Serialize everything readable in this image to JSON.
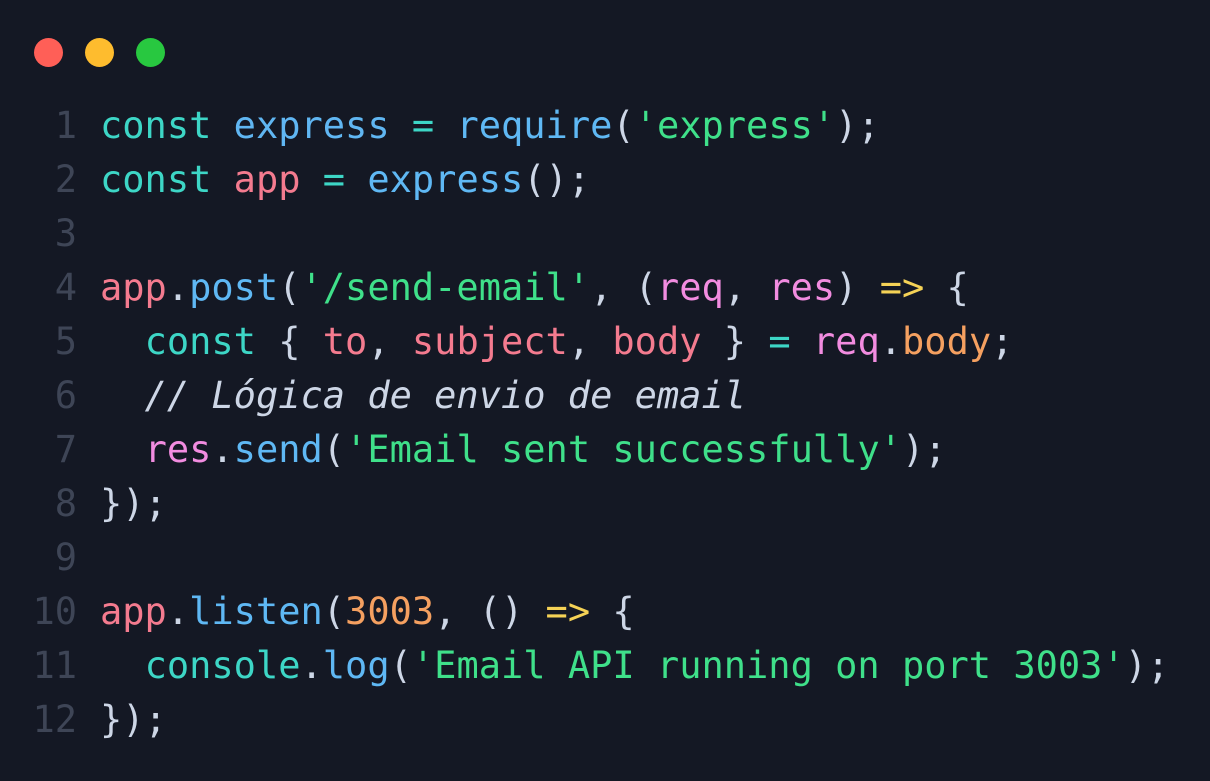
{
  "window": {
    "controls": [
      {
        "name": "close",
        "color": "#ff5f57"
      },
      {
        "name": "minimize",
        "color": "#febc2e"
      },
      {
        "name": "maximize",
        "color": "#28c840"
      }
    ]
  },
  "colors": {
    "background": "#141824",
    "keyword": "#3dd6c6",
    "variable": "#60b6f2",
    "variable_alt": "#f47b8f",
    "function": "#5fb8f4",
    "string": "#3fe08a",
    "param": "#f28ce0",
    "property": "#f5a060",
    "number": "#f5a060",
    "operator": "#f5d256",
    "punct": "#cdd6e6",
    "comment": "#cdd6e6",
    "line_number": "#3e4556"
  },
  "code": [
    {
      "n": "1",
      "tokens": [
        {
          "t": "const",
          "c": "keyword"
        },
        {
          "t": " ",
          "c": "punct"
        },
        {
          "t": "express",
          "c": "variable"
        },
        {
          "t": " ",
          "c": "punct"
        },
        {
          "t": "=",
          "c": "keyword"
        },
        {
          "t": " ",
          "c": "punct"
        },
        {
          "t": "require",
          "c": "function"
        },
        {
          "t": "(",
          "c": "punct"
        },
        {
          "t": "'express'",
          "c": "string"
        },
        {
          "t": ");",
          "c": "punct"
        }
      ]
    },
    {
      "n": "2",
      "tokens": [
        {
          "t": "const",
          "c": "keyword"
        },
        {
          "t": " ",
          "c": "punct"
        },
        {
          "t": "app",
          "c": "variable_alt"
        },
        {
          "t": " ",
          "c": "punct"
        },
        {
          "t": "=",
          "c": "keyword"
        },
        {
          "t": " ",
          "c": "punct"
        },
        {
          "t": "express",
          "c": "function"
        },
        {
          "t": "();",
          "c": "punct"
        }
      ]
    },
    {
      "n": "3",
      "tokens": []
    },
    {
      "n": "4",
      "tokens": [
        {
          "t": "app",
          "c": "variable_alt"
        },
        {
          "t": ".",
          "c": "punct"
        },
        {
          "t": "post",
          "c": "function"
        },
        {
          "t": "(",
          "c": "punct"
        },
        {
          "t": "'/send-email'",
          "c": "string"
        },
        {
          "t": ", (",
          "c": "punct"
        },
        {
          "t": "req",
          "c": "param"
        },
        {
          "t": ", ",
          "c": "punct"
        },
        {
          "t": "res",
          "c": "param"
        },
        {
          "t": ") ",
          "c": "punct"
        },
        {
          "t": "=>",
          "c": "operator"
        },
        {
          "t": " {",
          "c": "punct"
        }
      ]
    },
    {
      "n": "5",
      "tokens": [
        {
          "t": "  ",
          "c": "punct"
        },
        {
          "t": "const",
          "c": "keyword"
        },
        {
          "t": " { ",
          "c": "punct"
        },
        {
          "t": "to",
          "c": "variable_alt"
        },
        {
          "t": ", ",
          "c": "punct"
        },
        {
          "t": "subject",
          "c": "variable_alt"
        },
        {
          "t": ", ",
          "c": "punct"
        },
        {
          "t": "body",
          "c": "variable_alt"
        },
        {
          "t": " } ",
          "c": "punct"
        },
        {
          "t": "=",
          "c": "keyword"
        },
        {
          "t": " ",
          "c": "punct"
        },
        {
          "t": "req",
          "c": "param"
        },
        {
          "t": ".",
          "c": "punct"
        },
        {
          "t": "body",
          "c": "property"
        },
        {
          "t": ";",
          "c": "punct"
        }
      ]
    },
    {
      "n": "6",
      "tokens": [
        {
          "t": "  ",
          "c": "punct"
        },
        {
          "t": "// Lógica de envio de email",
          "c": "comment",
          "italic": true
        }
      ]
    },
    {
      "n": "7",
      "tokens": [
        {
          "t": "  ",
          "c": "punct"
        },
        {
          "t": "res",
          "c": "param"
        },
        {
          "t": ".",
          "c": "punct"
        },
        {
          "t": "send",
          "c": "function"
        },
        {
          "t": "(",
          "c": "punct"
        },
        {
          "t": "'Email sent successfully'",
          "c": "string"
        },
        {
          "t": ");",
          "c": "punct"
        }
      ]
    },
    {
      "n": "8",
      "tokens": [
        {
          "t": "});",
          "c": "punct"
        }
      ]
    },
    {
      "n": "9",
      "tokens": []
    },
    {
      "n": "10",
      "tokens": [
        {
          "t": "app",
          "c": "variable_alt"
        },
        {
          "t": ".",
          "c": "punct"
        },
        {
          "t": "listen",
          "c": "function"
        },
        {
          "t": "(",
          "c": "punct"
        },
        {
          "t": "3003",
          "c": "number"
        },
        {
          "t": ", () ",
          "c": "punct"
        },
        {
          "t": "=>",
          "c": "operator"
        },
        {
          "t": " {",
          "c": "punct"
        }
      ]
    },
    {
      "n": "11",
      "tokens": [
        {
          "t": "  ",
          "c": "punct"
        },
        {
          "t": "console",
          "c": "keyword"
        },
        {
          "t": ".",
          "c": "punct"
        },
        {
          "t": "log",
          "c": "function"
        },
        {
          "t": "(",
          "c": "punct"
        },
        {
          "t": "'Email API running on port 3003'",
          "c": "string"
        },
        {
          "t": ");",
          "c": "punct"
        }
      ]
    },
    {
      "n": "12",
      "tokens": [
        {
          "t": "});",
          "c": "punct"
        }
      ]
    }
  ]
}
